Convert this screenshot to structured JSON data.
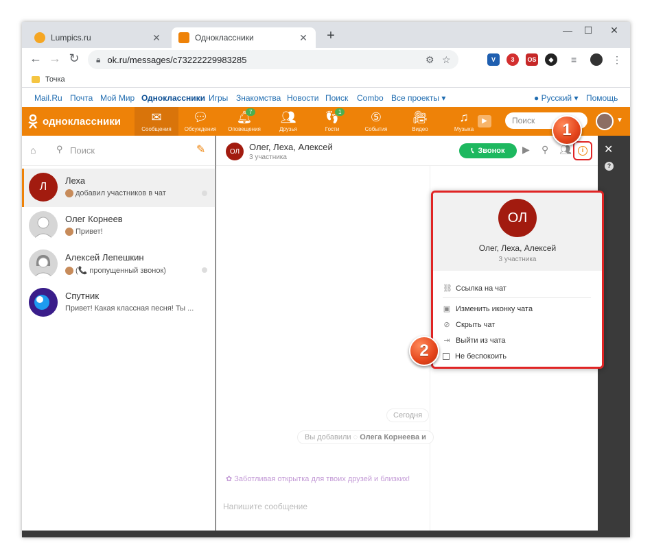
{
  "browser": {
    "tabs": [
      {
        "label": "Lumpics.ru",
        "active": false
      },
      {
        "label": "Одноклассники",
        "active": true
      }
    ],
    "url": "ok.ru/messages/c73222229983285",
    "bookmark": "Точка",
    "ext_badge": "3"
  },
  "topnav": {
    "links": [
      "Mail.Ru",
      "Почта",
      "Мой Мир",
      "Одноклассники",
      "Игры",
      "Знакомства",
      "Новости",
      "Поиск",
      "Combo",
      "Все проекты ▾"
    ],
    "language": "Русский ▾",
    "help": "Помощь"
  },
  "okbar": {
    "logo": "одноклассники",
    "items": [
      {
        "label": "Сообщения",
        "icon": "envelope-icon",
        "badge": ""
      },
      {
        "label": "Обсуждения",
        "icon": "chat-bubbles-icon",
        "badge": ""
      },
      {
        "label": "Оповещения",
        "icon": "bell-icon",
        "badge": "7"
      },
      {
        "label": "Друзья",
        "icon": "friends-icon",
        "badge": ""
      },
      {
        "label": "Гости",
        "icon": "footprints-icon",
        "badge": "1"
      },
      {
        "label": "События",
        "icon": "events-icon",
        "badge": ""
      },
      {
        "label": "Видео",
        "icon": "video-camera-icon",
        "badge": ""
      },
      {
        "label": "Музыка",
        "icon": "music-note-icon",
        "badge": ""
      }
    ],
    "search_placeholder": "Поиск"
  },
  "sidebar": {
    "search_placeholder": "Поиск",
    "chats": [
      {
        "name": "Леха",
        "initial": "Л",
        "preview": "добавил участников в чат",
        "color": "#a21b0f"
      },
      {
        "name": "Олег Корнеев",
        "initial": "",
        "preview": "Привет!",
        "color": "#d6d6d6"
      },
      {
        "name": "Алексей Лепешкин",
        "initial": "",
        "preview": "(📞 пропущенный звонок)",
        "color": "#d6d6d6"
      },
      {
        "name": "Спутник",
        "initial": "",
        "preview": "Привет! Какая классная песня! Ты ...",
        "color": "#3a1d8a"
      }
    ]
  },
  "chat": {
    "avatar_initials": "ОЛ",
    "title": "Олег, Леха, Алексей",
    "subtitle": "3 участника",
    "call_label": "Звонок",
    "date_chip": "Сегодня",
    "system_msg_prefix": "Вы добавили",
    "system_msg_name": "Олега Корнеева и",
    "promo": "Заботливая открытка для твоих друзей и близких!",
    "composer_placeholder": "Напишите сообщение"
  },
  "info_panel": {
    "avatar_initials": "ОЛ",
    "name": "Олег, Леха, Алексей",
    "subtitle": "3 участника",
    "items": [
      "Ссылка на чат",
      "Изменить иконку чата",
      "Скрыть чат",
      "Выйти из чата",
      "Не беспокоить"
    ]
  },
  "markers": [
    "1",
    "2"
  ],
  "colors": {
    "ok_orange": "#ee8208",
    "call_green": "#1db85f",
    "highlight_red": "#e02424",
    "avatar_red": "#a21b0f"
  }
}
